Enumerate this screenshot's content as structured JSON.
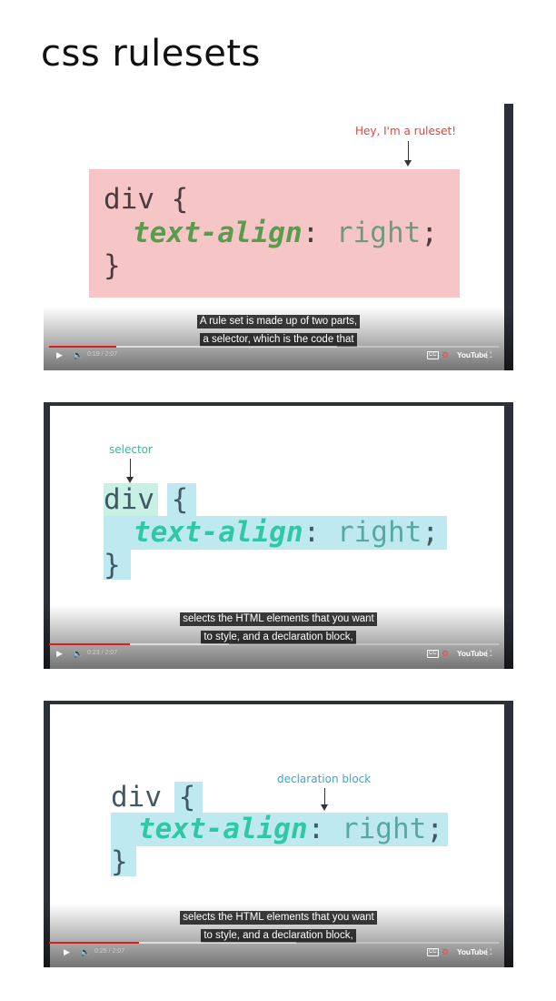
{
  "page": {
    "title": "css rulesets"
  },
  "players": [
    {
      "annotation": "Hey, I'm a ruleset!",
      "code": {
        "line1_sel": "div",
        "line1_brace": "{",
        "prop": "text-align",
        "colon": ":",
        "value": "right",
        "semicolon": ";",
        "close": "}"
      },
      "caption": [
        "A rule set is made up of two parts,",
        "a selector, which is the code that"
      ],
      "time": "0:19 / 2:07",
      "progress": 0.15,
      "brand": "YouTube"
    },
    {
      "annotation": "selector",
      "code": {
        "line1_sel": "div",
        "line1_brace": "{",
        "prop": "text-align",
        "colon": ":",
        "value": "right",
        "semicolon": ";",
        "close": "}"
      },
      "caption": [
        "selects the HTML elements that you want",
        "to style, and a declaration block,"
      ],
      "time": "0:23 / 2:07",
      "progress": 0.18,
      "brand": "YouTube"
    },
    {
      "annotation": "declaration block",
      "code": {
        "line1_sel": "div",
        "line1_brace": "{",
        "prop": "text-align",
        "colon": ":",
        "value": "right",
        "semicolon": ";",
        "close": "}"
      },
      "caption": [
        "selects the HTML elements that you want",
        "to style, and a declaration block,"
      ],
      "time": "0:25 / 2:07",
      "progress": 0.2,
      "brand": "YouTube"
    }
  ],
  "colors": {
    "ruleset_bg": "#f5c6c5",
    "highlight": "#bfe9f1",
    "selector_hl": "#c9f0e4",
    "prop_green": "#5a9c4e",
    "prop_teal": "#2fc7a4",
    "ann_red": "#d9473b",
    "ann_teal": "#2cbea0",
    "ann_blue": "#3aa7c9",
    "progress": "#e31b1b"
  }
}
